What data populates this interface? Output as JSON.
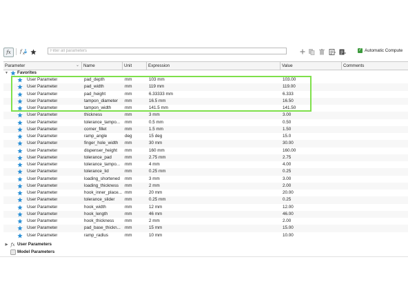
{
  "toolbar": {
    "search_placeholder": "Filter all parameters",
    "auto_compute_label": "Automatic Compute",
    "fx_label": "fx",
    "fx_small_label": "fx"
  },
  "columns": [
    "Parameter",
    "Name",
    "Unit",
    "Expression",
    "Value",
    "Comments"
  ],
  "groups": {
    "favorites": "Favorites",
    "user_parameters": "User Parameters",
    "model_parameters": "Model Parameters"
  },
  "colors": {
    "accent_star": "#2a8fd6",
    "highlight": "#7ee04a",
    "check": "#3c9a3c"
  },
  "rows": [
    {
      "param": "User Parameter",
      "name": "pad_depth",
      "unit": "mm",
      "expr": "103 mm",
      "value": "103.00"
    },
    {
      "param": "User Parameter",
      "name": "pad_width",
      "unit": "mm",
      "expr": "119 mm",
      "value": "119.00"
    },
    {
      "param": "User Parameter",
      "name": "pad_height",
      "unit": "mm",
      "expr": "6.33333 mm",
      "value": "6.333"
    },
    {
      "param": "User Parameter",
      "name": "tampon_diameter",
      "unit": "mm",
      "expr": "16.5 mm",
      "value": "16.50"
    },
    {
      "param": "User Parameter",
      "name": "tampon_width",
      "unit": "mm",
      "expr": "141.5 mm",
      "value": "141.50"
    },
    {
      "param": "User Parameter",
      "name": "thickness",
      "unit": "mm",
      "expr": "3 mm",
      "value": "3.00"
    },
    {
      "param": "User Parameter",
      "name": "tolerance_tampo...",
      "unit": "mm",
      "expr": "0.5 mm",
      "value": "0.50"
    },
    {
      "param": "User Parameter",
      "name": "corner_fillet",
      "unit": "mm",
      "expr": "1.5 mm",
      "value": "1.50"
    },
    {
      "param": "User Parameter",
      "name": "ramp_angle",
      "unit": "deg",
      "expr": "15 deg",
      "value": "15.0"
    },
    {
      "param": "User Parameter",
      "name": "finger_hole_width",
      "unit": "mm",
      "expr": "30 mm",
      "value": "30.00"
    },
    {
      "param": "User Parameter",
      "name": "dispenser_height",
      "unit": "mm",
      "expr": "160 mm",
      "value": "160.00"
    },
    {
      "param": "User Parameter",
      "name": "tolerance_pad",
      "unit": "mm",
      "expr": "2.75 mm",
      "value": "2.75"
    },
    {
      "param": "User Parameter",
      "name": "tolerance_tampo...",
      "unit": "mm",
      "expr": "4 mm",
      "value": "4.00"
    },
    {
      "param": "User Parameter",
      "name": "tolerance_lid",
      "unit": "mm",
      "expr": "0.25 mm",
      "value": "0.25"
    },
    {
      "param": "User Parameter",
      "name": "loading_shortened",
      "unit": "mm",
      "expr": "3 mm",
      "value": "3.00"
    },
    {
      "param": "User Parameter",
      "name": "loading_thickness",
      "unit": "mm",
      "expr": "2 mm",
      "value": "2.00"
    },
    {
      "param": "User Parameter",
      "name": "hook_inner_place...",
      "unit": "mm",
      "expr": "20 mm",
      "value": "20.00"
    },
    {
      "param": "User Parameter",
      "name": "tolerance_slider",
      "unit": "mm",
      "expr": "0.25 mm",
      "value": "0.25"
    },
    {
      "param": "User Parameter",
      "name": "hook_width",
      "unit": "mm",
      "expr": "12 mm",
      "value": "12.00"
    },
    {
      "param": "User Parameter",
      "name": "hook_length",
      "unit": "mm",
      "expr": "46 mm",
      "value": "46.00"
    },
    {
      "param": "User Parameter",
      "name": "hook_thickness",
      "unit": "mm",
      "expr": "2 mm",
      "value": "2.00"
    },
    {
      "param": "User Parameter",
      "name": "pad_base_thickn...",
      "unit": "mm",
      "expr": "15 mm",
      "value": "15.00"
    },
    {
      "param": "User Parameter",
      "name": "ramp_radius",
      "unit": "mm",
      "expr": "10 mm",
      "value": "10.00"
    }
  ]
}
